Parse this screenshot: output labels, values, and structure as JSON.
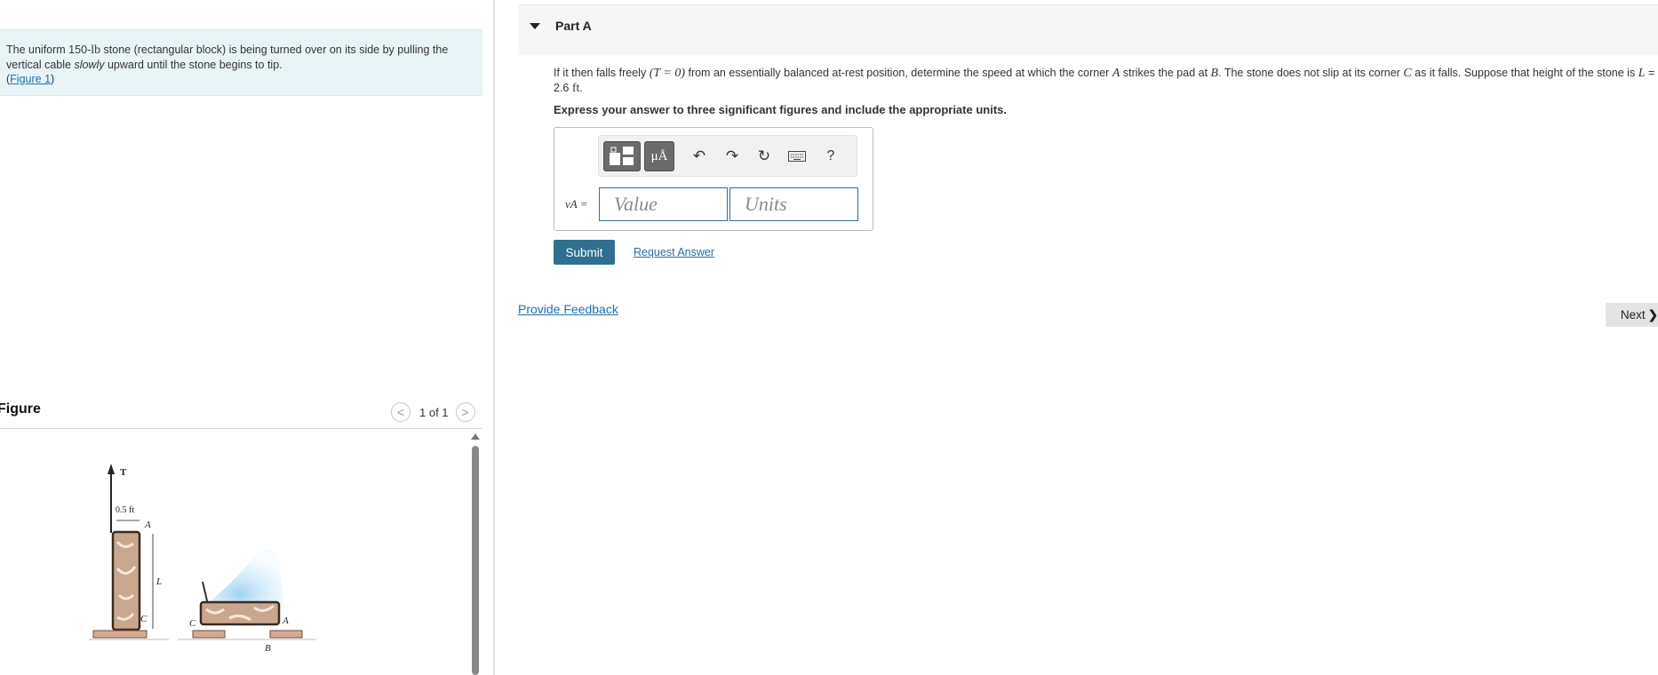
{
  "problem": {
    "text_before": "The uniform 150-",
    "weight_unit": "lb",
    "text_middle": " stone (rectangular block) is being turned over on its side by pulling the vertical cable ",
    "text_emphasis": "slowly",
    "text_after": " upward until the stone begins to tip.",
    "figure_link_open": "(",
    "figure_link": "Figure 1",
    "figure_link_close": ")"
  },
  "figure_panel": {
    "title": "Figure",
    "pager_prev": "<",
    "pager_text": "1 of 1",
    "pager_next": ">",
    "labels": {
      "tension": "T",
      "width": "0.5 ft",
      "corner_a": "A",
      "length": "L",
      "corner_c": "C",
      "corner_c2": "C",
      "corner_a2": "A",
      "pad_b": "B"
    }
  },
  "part": {
    "title": "Part A",
    "question": {
      "q1": "If it then falls freely ",
      "q2": "(T = 0)",
      "q3": " from an essentially balanced at-rest position, determine the speed at which the corner ",
      "q4": "A",
      "q5": " strikes the pad at ",
      "q6": "B",
      "q7": ". The stone does not slip at its corner ",
      "q8": "C",
      "q9": " as it falls. Suppose that height of the stone is ",
      "q10": "L",
      "q11": " = 2.6 ",
      "q12": "ft",
      "q13": "."
    },
    "instruction": "Express your answer to three significant figures and include the appropriate units.",
    "answer": {
      "variable": "vA =",
      "value_placeholder": "Value",
      "units_placeholder": "Units",
      "toolbar": {
        "units_button": "μÅ",
        "help": "?"
      }
    },
    "submit_label": "Submit",
    "request_answer_label": "Request Answer"
  },
  "feedback_label": "Provide Feedback",
  "next_label": "Next",
  "next_arrow": "❯",
  "colors": {
    "accent": "#2f6f8f",
    "link": "#1f6fa8",
    "problem_bg": "#e9f4f7"
  }
}
